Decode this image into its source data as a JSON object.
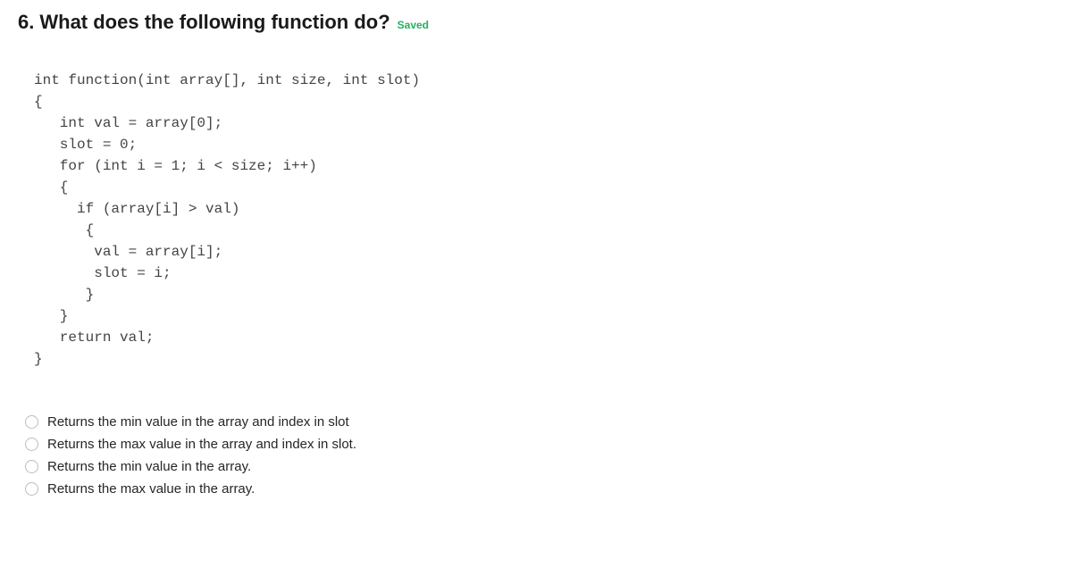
{
  "question": {
    "number": "6.",
    "text": "What does the following function do?",
    "saved_label": "Saved"
  },
  "code": "int function(int array[], int size, int slot)\n{\n   int val = array[0];\n   slot = 0;\n   for (int i = 1; i < size; i++)\n   {\n     if (array[i] > val)\n      {\n       val = array[i];\n       slot = i;\n      }\n   }\n   return val;\n}",
  "options": [
    {
      "label": "Returns the min value in the array and index in slot"
    },
    {
      "label": "Returns the max value in the array and index in slot."
    },
    {
      "label": "Returns the min value in the array."
    },
    {
      "label": "Returns the max value in the array."
    }
  ]
}
